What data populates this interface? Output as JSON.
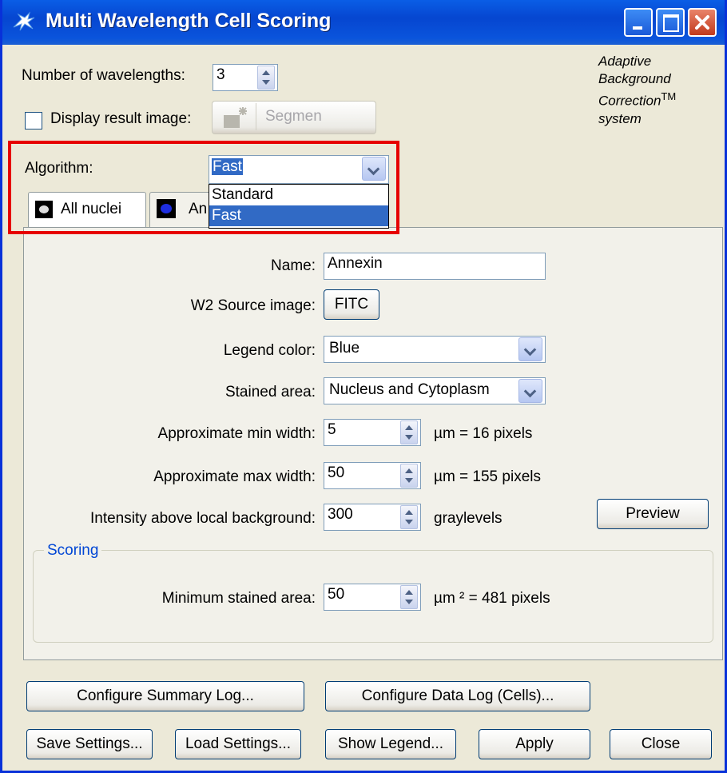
{
  "window": {
    "title": "Multi Wavelength Cell Scoring"
  },
  "header": {
    "num_wavelengths_label": "Number of wavelengths:",
    "num_wavelengths_value": "3",
    "display_result_label": "Display result image:",
    "segment_button": "Segmen",
    "brand_line1": "Adaptive",
    "brand_line2": "Background",
    "brand_line3": "Correction",
    "brand_tm": "TM",
    "brand_line4": "system"
  },
  "algorithm": {
    "label": "Algorithm:",
    "value": "Fast",
    "options": [
      "Standard",
      "Fast"
    ]
  },
  "tabs": [
    {
      "label": "All nuclei"
    },
    {
      "label": "An"
    }
  ],
  "form": {
    "name_label": "Name:",
    "name_value": "Annexin",
    "source_label": "W2 Source image:",
    "source_value": "FITC",
    "legend_label": "Legend color:",
    "legend_value": "Blue",
    "stained_label": "Stained area:",
    "stained_value": "Nucleus and Cytoplasm",
    "min_width_label": "Approximate min width:",
    "min_width_value": "5",
    "min_width_unit": "µm = 16 pixels",
    "max_width_label": "Approximate max width:",
    "max_width_value": "50",
    "max_width_unit": "µm = 155 pixels",
    "intensity_label": "Intensity above local background:",
    "intensity_value": "300",
    "intensity_unit": "graylevels",
    "preview_button": "Preview"
  },
  "scoring": {
    "group_label": "Scoring",
    "min_area_label": "Minimum stained area:",
    "min_area_value": "50",
    "min_area_unit": "µm ² = 481 pixels"
  },
  "buttons": {
    "summary_log": "Configure Summary Log...",
    "data_log": "Configure Data Log (Cells)...",
    "save_settings": "Save Settings...",
    "load_settings": "Load Settings...",
    "show_legend": "Show Legend...",
    "apply": "Apply",
    "close": "Close"
  },
  "colors": {
    "title_bar": "#0a5ee6",
    "highlight": "#e60000",
    "selection": "#316ac5"
  }
}
